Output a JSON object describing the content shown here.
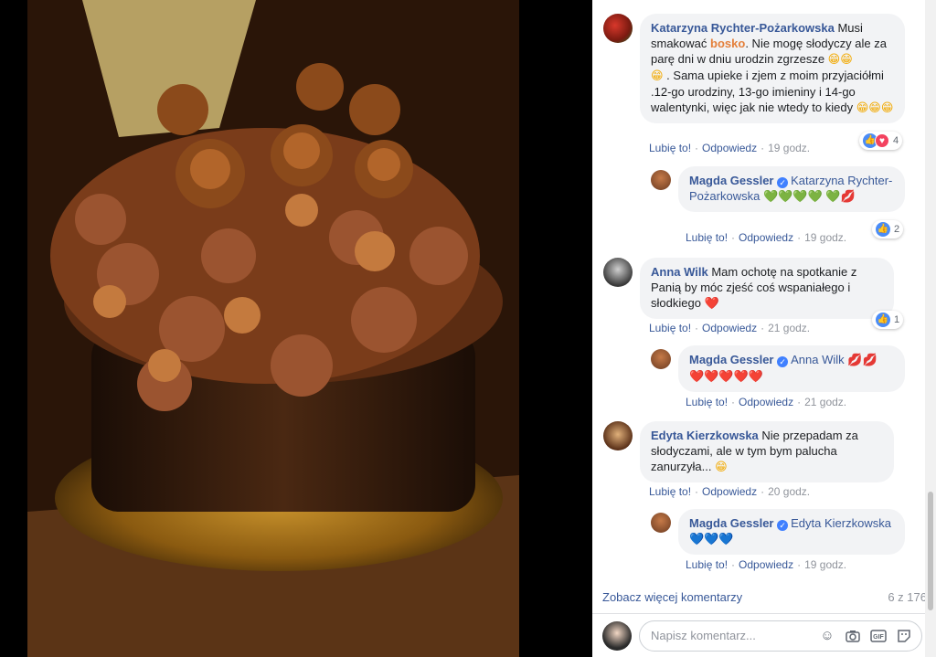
{
  "comments": [
    {
      "author": "Katarzyna Rychter-Pożarkowska",
      "text_before": " Musi smakować ",
      "highlight": "bosko",
      "text_after": ". Nie mogę słodyczy ale za parę dni w dniu urodzin zgrzesze ",
      "emoji1": "😁😁",
      "emoji2": "😁",
      "text_after2": " . Sama upieke i zjem z moim przyjaciółmi .12-go urodziny, 13-go imieniny i 14-go walentynki, więc jak nie wtedy to kiedy ",
      "emoji3": "😁😁😁",
      "like": "Lubię to!",
      "reply": "Odpowiedz",
      "time": "19 godz.",
      "reaction_count": "4"
    },
    {
      "author": "Magda Gessler",
      "mention": "Katarzyna Rychter-Pożarkowska",
      "emoji": "💚💚💚💚",
      "emoji2": "💚💋",
      "like": "Lubię to!",
      "reply": "Odpowiedz",
      "time": "19 godz.",
      "reaction_count": "2"
    },
    {
      "author": "Anna Wilk",
      "text": " Mam ochotę na spotkanie z Panią by móc zjeść coś wspaniałego i słodkiego ",
      "emoji": "❤️",
      "like": "Lubię to!",
      "reply": "Odpowiedz",
      "time": "21 godz.",
      "reaction_count": "1"
    },
    {
      "author": "Magda Gessler",
      "mention": "Anna Wilk",
      "emoji": "💋💋",
      "emoji2": "❤️❤️❤️❤️❤️",
      "like": "Lubię to!",
      "reply": "Odpowiedz",
      "time": "21 godz."
    },
    {
      "author": "Edyta Kierzkowska",
      "text": " Nie przepadam za słodyczami, ale w tym bym palucha zanurzyła... ",
      "emoji": "😁",
      "like": "Lubię to!",
      "reply": "Odpowiedz",
      "time": "20 godz."
    },
    {
      "author": "Magda Gessler",
      "mention": "Edyta Kierzkowska",
      "emoji": "💙💙💙",
      "like": "Lubię to!",
      "reply": "Odpowiedz",
      "time": "19 godz."
    }
  ],
  "more_comments": "Zobacz więcej komentarzy",
  "page_count": "6 z 176",
  "compose_placeholder": "Napisz komentarz...",
  "colors": {
    "link": "#385898",
    "bubble": "#f2f3f5",
    "highlight": "#e4803c"
  }
}
